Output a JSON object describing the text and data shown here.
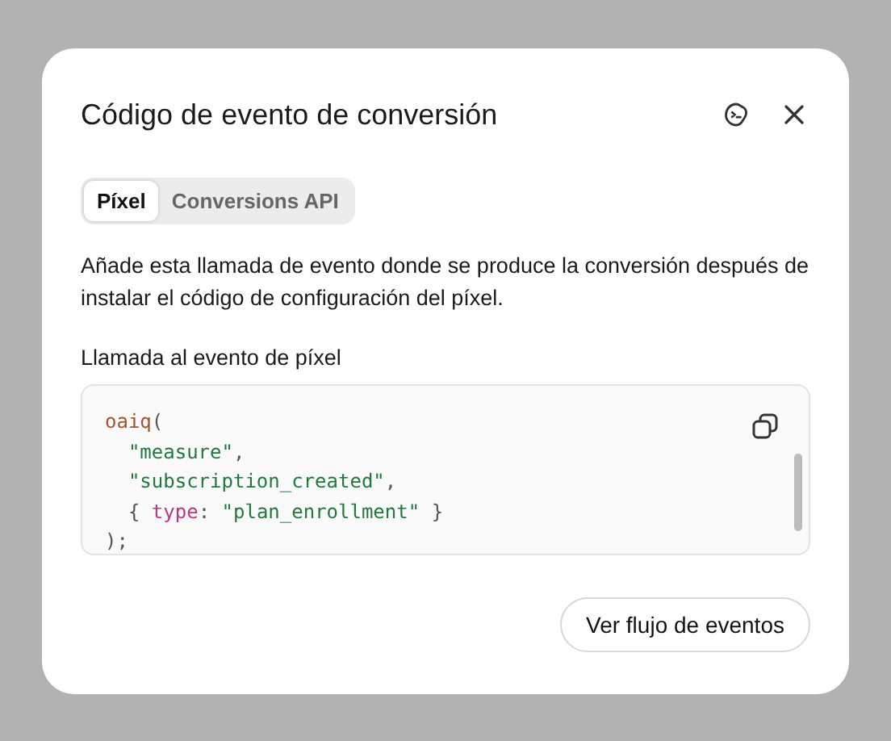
{
  "dialog": {
    "title": "Código de evento de conversión"
  },
  "tabs": [
    {
      "label": "Píxel",
      "selected": true
    },
    {
      "label": "Conversions API",
      "selected": false
    }
  ],
  "description": "Añade esta llamada de evento donde se produce la conversión después de instalar el código de configuración del píxel.",
  "code_label": "Llamada al evento de píxel",
  "code_lines": [
    [
      {
        "kind": "function",
        "text": "oaiq"
      },
      {
        "kind": "punct",
        "text": "("
      }
    ],
    [
      {
        "kind": "string",
        "text": "  \"measure\""
      },
      {
        "kind": "punct",
        "text": ","
      }
    ],
    [
      {
        "kind": "string",
        "text": "  \"subscription_created\""
      },
      {
        "kind": "punct",
        "text": ","
      }
    ],
    [
      {
        "kind": "punct",
        "text": "  { "
      },
      {
        "kind": "key",
        "text": "type"
      },
      {
        "kind": "punct",
        "text": ": "
      },
      {
        "kind": "string",
        "text": "\"plan_enrollment\""
      },
      {
        "kind": "punct",
        "text": " }"
      }
    ],
    [
      {
        "kind": "punct",
        "text": ");"
      }
    ]
  ],
  "footer_button": "Ver flujo de eventos"
}
